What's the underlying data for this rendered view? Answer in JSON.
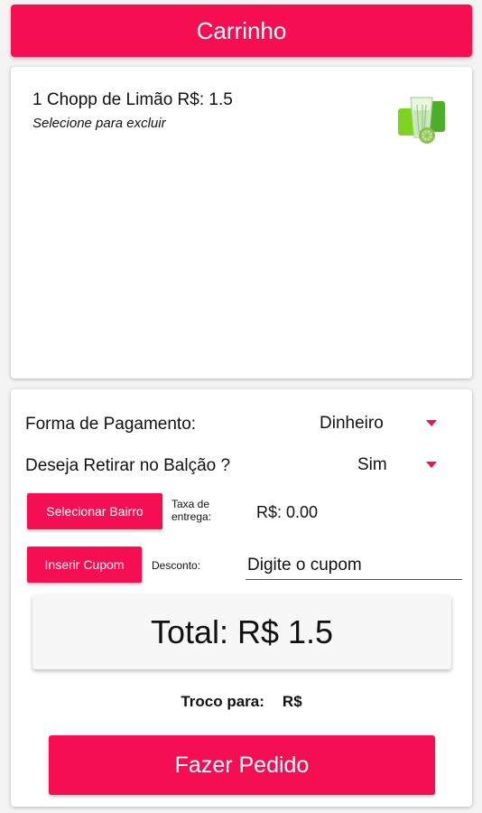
{
  "header": {
    "title": "Carrinho"
  },
  "cart": {
    "items": [
      {
        "title": "1 Chopp de Limão R$: 1.5",
        "hint": "Selecione para excluir",
        "icon": "lime-chopp-drink-icon"
      }
    ]
  },
  "order": {
    "payment_label": "Forma de Pagamento:",
    "payment_value": "Dinheiro",
    "pickup_label": "Deseja Retirar no Balção ?",
    "pickup_value": "Sim",
    "neighborhood_button": "Selecionar Bairro",
    "delivery_fee_label_1": "Taxa de",
    "delivery_fee_label_2": "entrega:",
    "delivery_fee_value": "R$: 0.00",
    "coupon_button": "Inserir Cupom",
    "discount_label": "Desconto:",
    "coupon_placeholder": "Digite o cupom",
    "total": "Total: R$ 1.5",
    "change_label": "Troco para:",
    "change_value": "R$",
    "submit_button": "Fazer Pedido"
  },
  "colors": {
    "accent": "#f50f52",
    "background": "#f3f3f3",
    "card": "#ffffff"
  }
}
